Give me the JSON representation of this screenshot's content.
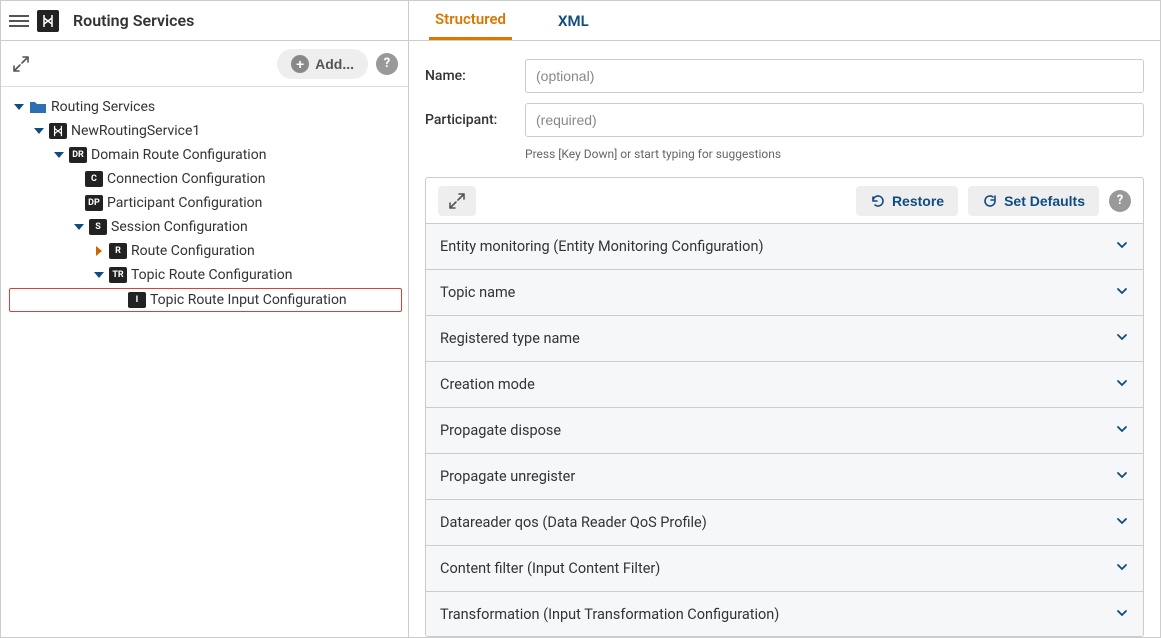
{
  "header": {
    "title": "Routing Services",
    "add_label": "Add..."
  },
  "tree": {
    "root": {
      "label": "Routing Services"
    },
    "service": {
      "label": "NewRoutingService1"
    },
    "domain_route": {
      "label": "Domain Route Configuration",
      "badge": "DR"
    },
    "connection": {
      "label": "Connection Configuration",
      "badge": "C"
    },
    "participant": {
      "label": "Participant Configuration",
      "badge": "DP"
    },
    "session": {
      "label": "Session Configuration",
      "badge": "S"
    },
    "route": {
      "label": "Route Configuration",
      "badge": "R"
    },
    "topic_route": {
      "label": "Topic Route Configuration",
      "badge": "TR"
    },
    "topic_route_input": {
      "label": "Topic Route Input Configuration",
      "badge": "I"
    }
  },
  "tabs": {
    "structured": "Structured",
    "xml": "XML"
  },
  "form": {
    "name_label": "Name:",
    "name_placeholder": "(optional)",
    "participant_label": "Participant:",
    "participant_placeholder": "(required)",
    "hint": "Press [Key Down] or start typing for suggestions"
  },
  "actions": {
    "restore": "Restore",
    "set_defaults": "Set Defaults"
  },
  "properties": [
    "Entity monitoring (Entity Monitoring Configuration)",
    "Topic name",
    "Registered type name",
    "Creation mode",
    "Propagate dispose",
    "Propagate unregister",
    "Datareader qos (Data Reader QoS Profile)",
    "Content filter (Input Content Filter)",
    "Transformation (Input Transformation Configuration)"
  ]
}
